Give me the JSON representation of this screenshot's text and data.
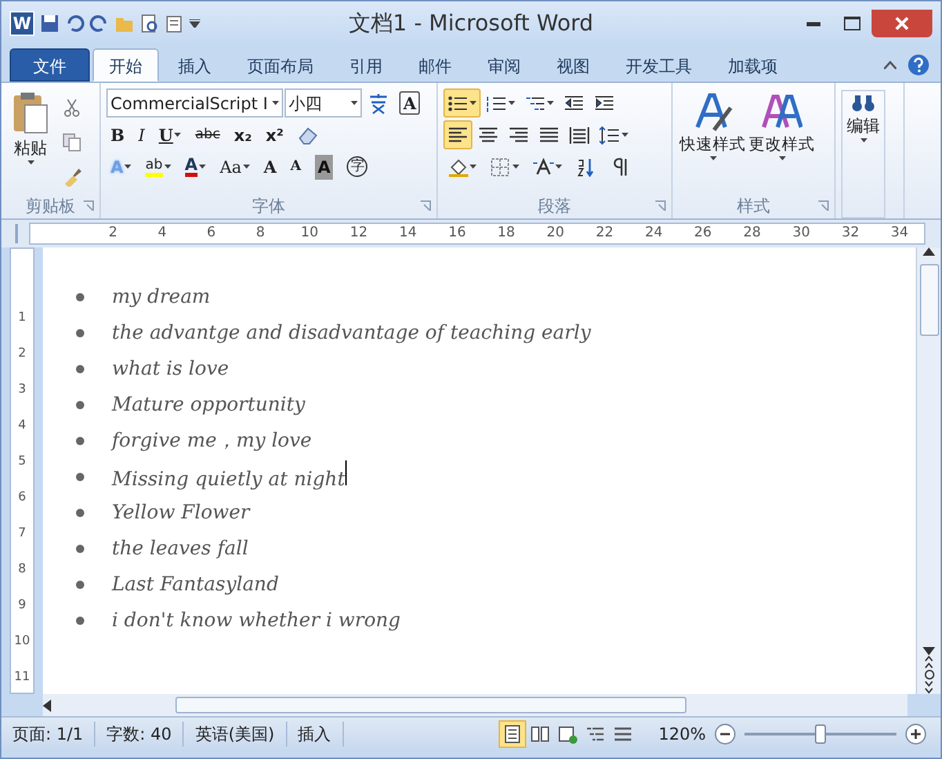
{
  "window": {
    "app_icon": "W",
    "title": "文档1 - Microsoft Word"
  },
  "tabs": [
    {
      "label": "文件",
      "kind": "file",
      "selected": false
    },
    {
      "label": "开始",
      "kind": "tab",
      "selected": true
    },
    {
      "label": "插入",
      "kind": "tab",
      "selected": false
    },
    {
      "label": "页面布局",
      "kind": "tab",
      "selected": false
    },
    {
      "label": "引用",
      "kind": "tab",
      "selected": false
    },
    {
      "label": "邮件",
      "kind": "tab",
      "selected": false
    },
    {
      "label": "审阅",
      "kind": "tab",
      "selected": false
    },
    {
      "label": "视图",
      "kind": "tab",
      "selected": false
    },
    {
      "label": "开发工具",
      "kind": "tab",
      "selected": false
    },
    {
      "label": "加载项",
      "kind": "tab",
      "selected": false
    }
  ],
  "ribbon": {
    "clipboard": {
      "paste": "粘贴",
      "label": "剪贴板"
    },
    "font": {
      "font_name": "CommercialScript I",
      "font_size": "小四",
      "border_char": "A",
      "label": "字体",
      "row_2": [
        {
          "kind": "bold",
          "text": "B"
        },
        {
          "kind": "italic",
          "text": "I"
        },
        {
          "kind": "underline",
          "text": "U"
        },
        {
          "kind": "strike",
          "text": "abc"
        },
        {
          "kind": "sub",
          "text": "x₂"
        },
        {
          "kind": "sup",
          "text": "x²"
        }
      ],
      "row_3": [
        {
          "kind": "effect",
          "text": "A"
        },
        {
          "kind": "highlight",
          "text": "ab"
        },
        {
          "kind": "color",
          "text": "A"
        },
        {
          "kind": "case",
          "text": "Aa"
        },
        {
          "kind": "grow",
          "text": "A"
        },
        {
          "kind": "shrink",
          "text": "A"
        },
        {
          "kind": "shade",
          "text": "A"
        },
        {
          "kind": "enclose",
          "text": "字"
        }
      ]
    },
    "paragraph": {
      "label": "段落",
      "lists": [
        {
          "kind": "bullets",
          "selected": true
        },
        {
          "kind": "numbering",
          "selected": false
        },
        {
          "kind": "multilevel",
          "selected": false
        }
      ],
      "align": [
        {
          "kind": "left",
          "selected": true
        },
        {
          "kind": "center",
          "selected": false
        },
        {
          "kind": "right",
          "selected": false
        },
        {
          "kind": "justify",
          "selected": false
        },
        {
          "kind": "distributed",
          "selected": false
        }
      ]
    },
    "styles": {
      "label": "样式",
      "buttons": [
        "快速样式",
        "更改样式"
      ]
    },
    "editing": {
      "label": "编辑"
    }
  },
  "ruler": {
    "marks": [
      "2",
      "4",
      "6",
      "8",
      "10",
      "12",
      "14",
      "16",
      "18",
      "20",
      "22",
      "24",
      "26",
      "28",
      "30",
      "32",
      "34"
    ]
  },
  "vertical_ruler": {
    "marks": [
      "1",
      "2",
      "3",
      "4",
      "5",
      "6",
      "7",
      "8",
      "9",
      "10",
      "11"
    ]
  },
  "document": {
    "items": [
      {
        "text": "my dream",
        "caret": false
      },
      {
        "text": "the advantge and disadvantage of teaching early",
        "caret": false
      },
      {
        "text": "what is love",
        "caret": false
      },
      {
        "text": "Mature opportunity",
        "caret": false
      },
      {
        "text": "forgive me，my love",
        "caret": false
      },
      {
        "text": "Missing quietly at night",
        "caret": true
      },
      {
        "text": "Yellow Flower",
        "caret": false
      },
      {
        "text": "the leaves fall",
        "caret": false
      },
      {
        "text": "Last Fantasyland",
        "caret": false
      },
      {
        "text": "i don't know whether i wrong",
        "caret": false
      }
    ]
  },
  "status_bar": {
    "page": "页面: 1/1",
    "words": "字数: 40",
    "language": "英语(美国)",
    "mode": "插入",
    "views": [
      {
        "kind": "print",
        "selected": true
      },
      {
        "kind": "reading",
        "selected": false
      },
      {
        "kind": "web",
        "selected": false
      },
      {
        "kind": "outline",
        "selected": false
      },
      {
        "kind": "draft",
        "selected": false
      }
    ],
    "zoom": "120%",
    "zoom_slider": {
      "level": 0.5
    }
  }
}
